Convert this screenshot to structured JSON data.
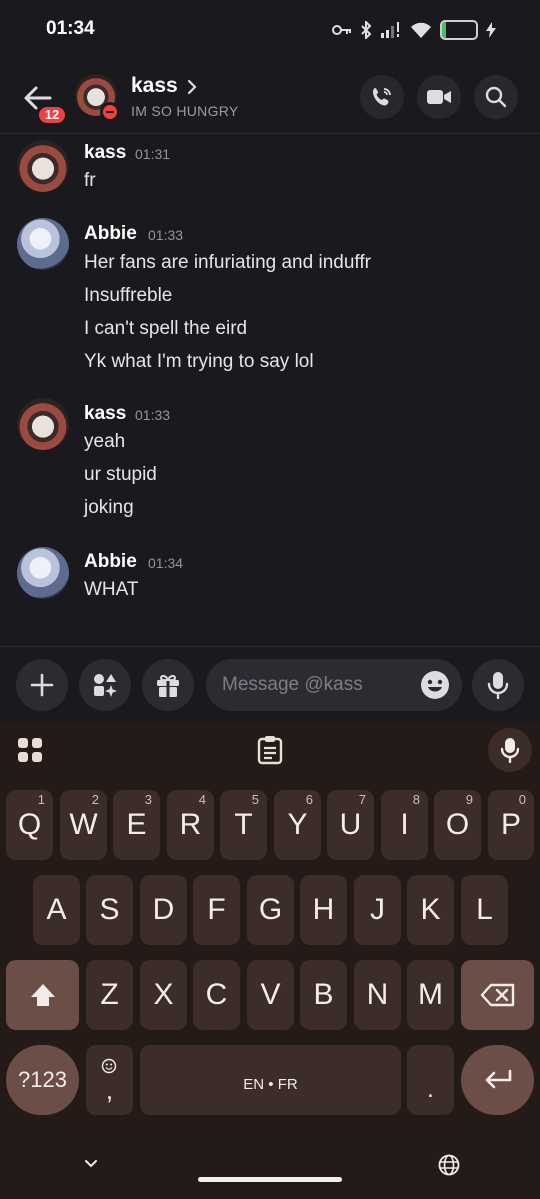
{
  "status": {
    "time": "01:34",
    "battery": "12",
    "battery_level": 0.12
  },
  "header": {
    "back_badge": "12",
    "name": "kass",
    "status_text": "IM SO HUNGRY",
    "buttons": [
      "phone-icon",
      "video-icon",
      "search-icon"
    ]
  },
  "messages": [
    {
      "author": "kass",
      "time": "01:31",
      "lines": [
        "fr"
      ]
    },
    {
      "author": "Abbie",
      "time": "01:33",
      "lines": [
        "Her fans are infuriating and induffr",
        "Insuffreble",
        "I can't spell the eird",
        "Yk what I'm trying to say lol"
      ]
    },
    {
      "author": "kass",
      "time": "01:33",
      "lines": [
        "yeah",
        "ur stupid",
        "joking"
      ]
    },
    {
      "author": "Abbie",
      "time": "01:34",
      "lines": [
        "WHAT"
      ]
    }
  ],
  "composer": {
    "placeholder": "Message @kass"
  },
  "keyboard": {
    "row1": [
      {
        "label": "Q",
        "hint": "1"
      },
      {
        "label": "W",
        "hint": "2"
      },
      {
        "label": "E",
        "hint": "3"
      },
      {
        "label": "R",
        "hint": "4"
      },
      {
        "label": "T",
        "hint": "5"
      },
      {
        "label": "Y",
        "hint": "6"
      },
      {
        "label": "U",
        "hint": "7"
      },
      {
        "label": "I",
        "hint": "8"
      },
      {
        "label": "O",
        "hint": "9"
      },
      {
        "label": "P",
        "hint": "0"
      }
    ],
    "row2": [
      "A",
      "S",
      "D",
      "F",
      "G",
      "H",
      "J",
      "K",
      "L"
    ],
    "row3": [
      "Z",
      "X",
      "C",
      "V",
      "B",
      "N",
      "M"
    ],
    "symbols": "?123",
    "comma": ",",
    "space": "EN • FR",
    "period": ".",
    "colors": {
      "key": "#3c2d29",
      "special": "#6b4e45",
      "background": "#241b18"
    }
  }
}
